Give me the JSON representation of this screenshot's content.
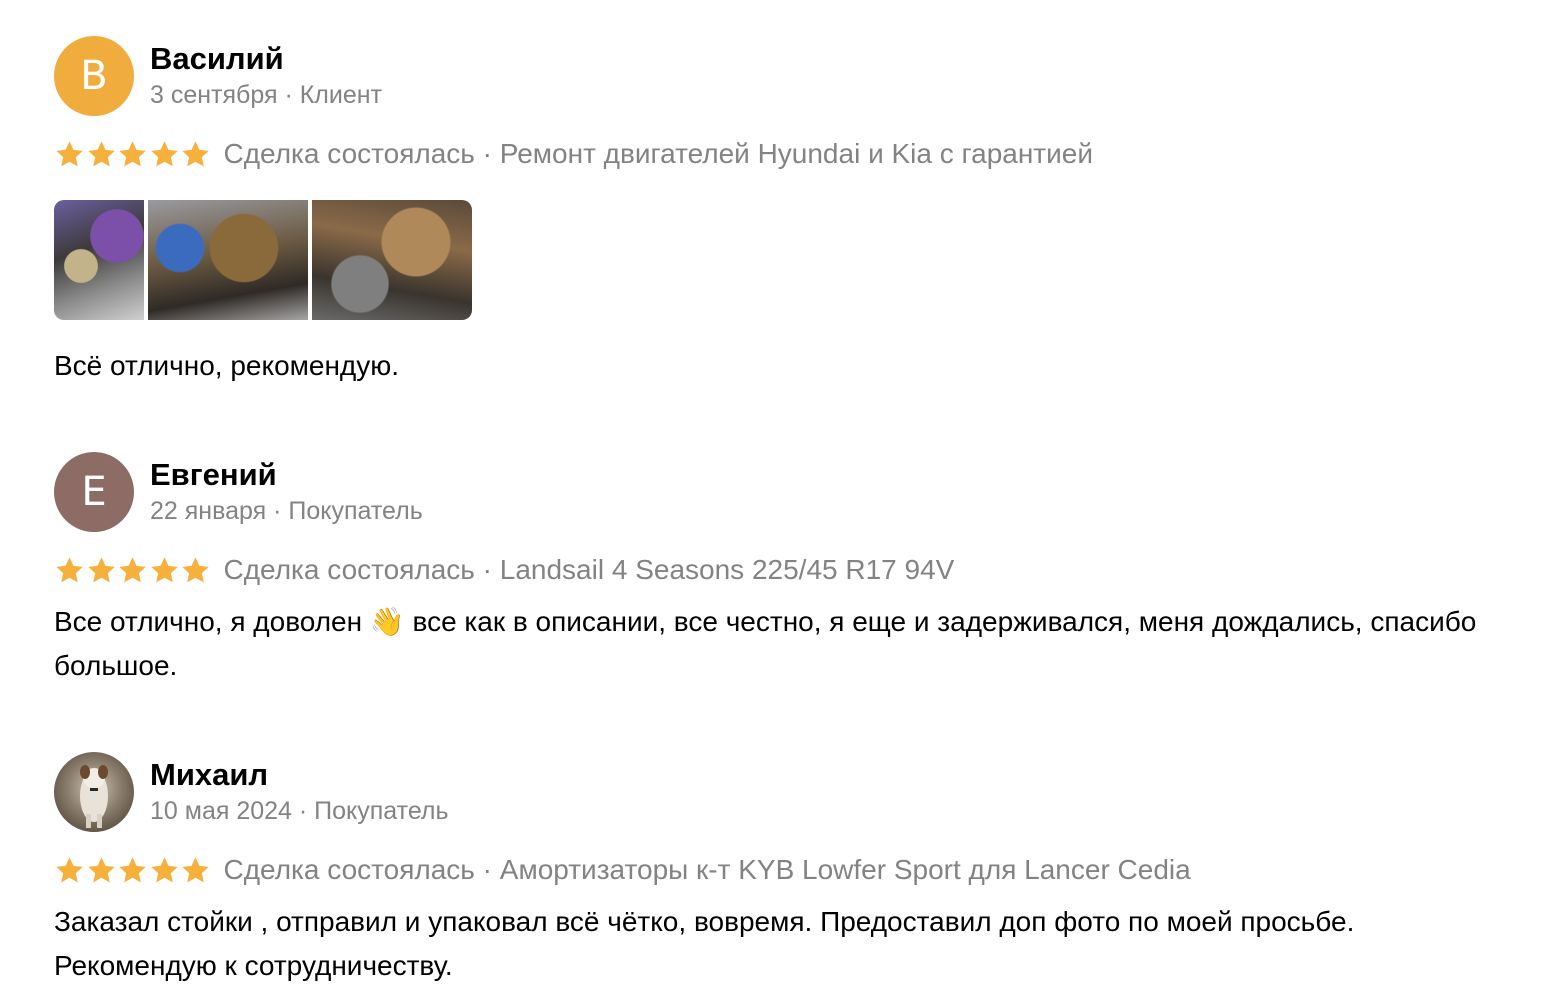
{
  "colors": {
    "star": "#F6B03B",
    "meta_text": "#838383",
    "body_text": "#000000"
  },
  "reviews": [
    {
      "author": "Василий",
      "avatar_letter": "В",
      "avatar_color": "#F0AC3C",
      "date": "3 сентября",
      "role": "Клиент",
      "meta": "3 сентября · Клиент",
      "rating": 5,
      "deal": "Сделка состоялась · Ремонт двигателей Hyundai и Kia с гарантией",
      "photos": [
        "engine-photo-1",
        "engine-photo-2",
        "engine-photo-3"
      ],
      "text": "Всё отлично, рекомендую."
    },
    {
      "author": "Евгений",
      "avatar_letter": "Е",
      "avatar_color": "#8C6C64",
      "date": "22 января",
      "role": "Покупатель",
      "meta": "22 января · Покупатель",
      "rating": 5,
      "deal": "Сделка состоялась · Landsail 4 Seasons 225/45 R17 94V",
      "text": "Все отлично, я доволен 👋 все как в описании, все честно, я еще и задерживался, меня дождались, спасибо большое."
    },
    {
      "author": "Михаил",
      "avatar_image": "dog-photo",
      "date": "10 мая 2024",
      "role": "Покупатель",
      "meta": "10 мая 2024 · Покупатель",
      "rating": 5,
      "deal": "Сделка состоялась · Амортизаторы к-т KYB Lowfer Sport для Lancer Cedia",
      "text": "Заказал стойки , отправил и упаковал всё чётко, вовремя. Предоставил доп фото по моей просьбе. Рекомендую к сотрудничеству."
    }
  ]
}
